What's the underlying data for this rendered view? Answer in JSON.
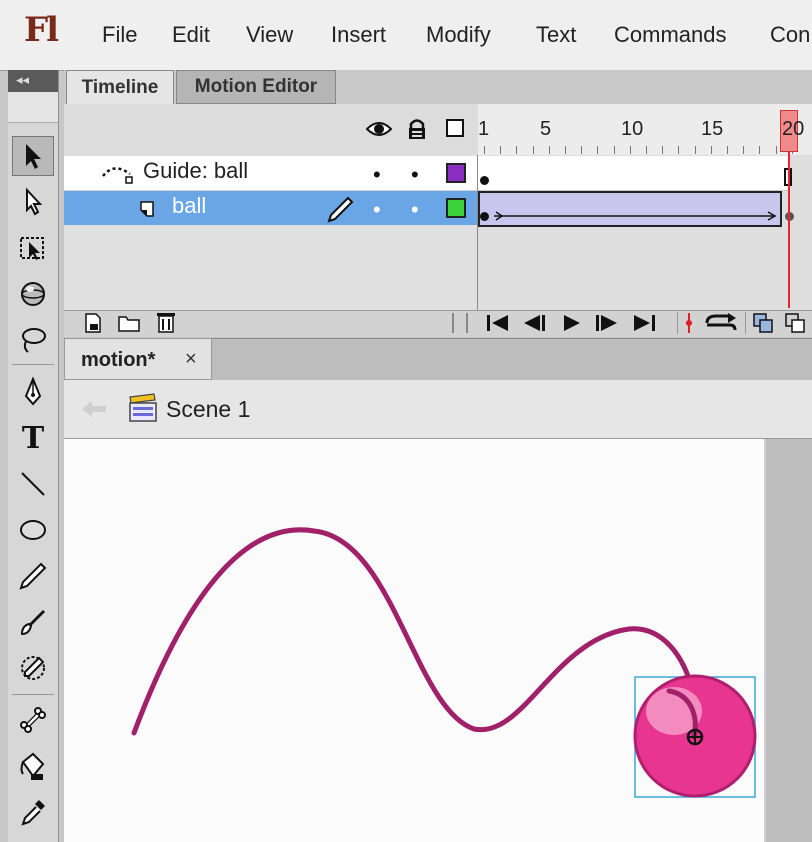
{
  "app": {
    "logo": "Fl",
    "menu": [
      "File",
      "Edit",
      "View",
      "Insert",
      "Modify",
      "Text",
      "Commands",
      "Con"
    ]
  },
  "toolbar": {
    "collapse_glyph": "◂◂",
    "tools": [
      "selection-tool",
      "subselection-tool",
      "free-transform-tool",
      "3d-rotation-tool",
      "lasso-tool",
      "pen-tool",
      "text-tool",
      "line-tool",
      "oval-tool",
      "pencil-tool",
      "brush-tool",
      "deco-tool",
      "bone-tool",
      "paint-bucket-tool",
      "eyedropper-tool"
    ],
    "selected_tool": "selection-tool",
    "text_tool_glyph": "T"
  },
  "timeline": {
    "tabs": [
      "Timeline",
      "Motion Editor"
    ],
    "active_tab": "Timeline",
    "frame_numbers": [
      "1",
      "5",
      "10",
      "15",
      "20"
    ],
    "current_frame": "20",
    "layers": [
      {
        "name": "Guide: ball",
        "type": "guide",
        "visible_dot": "•",
        "lock_dot": "•",
        "outline_color": "#8a2ec2"
      },
      {
        "name": "ball",
        "type": "guided",
        "selected": true,
        "visible_dot": "•",
        "lock_dot": "•",
        "outline_color": "#3ad23a"
      }
    ]
  },
  "document": {
    "tab_label": "motion*",
    "close_glyph": "×",
    "scene": "Scene 1"
  },
  "colors": {
    "path": "#a0206a",
    "ball_fill": "#e8358f",
    "ball_highlight": "#f59ac8",
    "selection_box": "#3aa8d8",
    "layer_selected": "#6aa6e6",
    "playhead": "#e02020"
  }
}
